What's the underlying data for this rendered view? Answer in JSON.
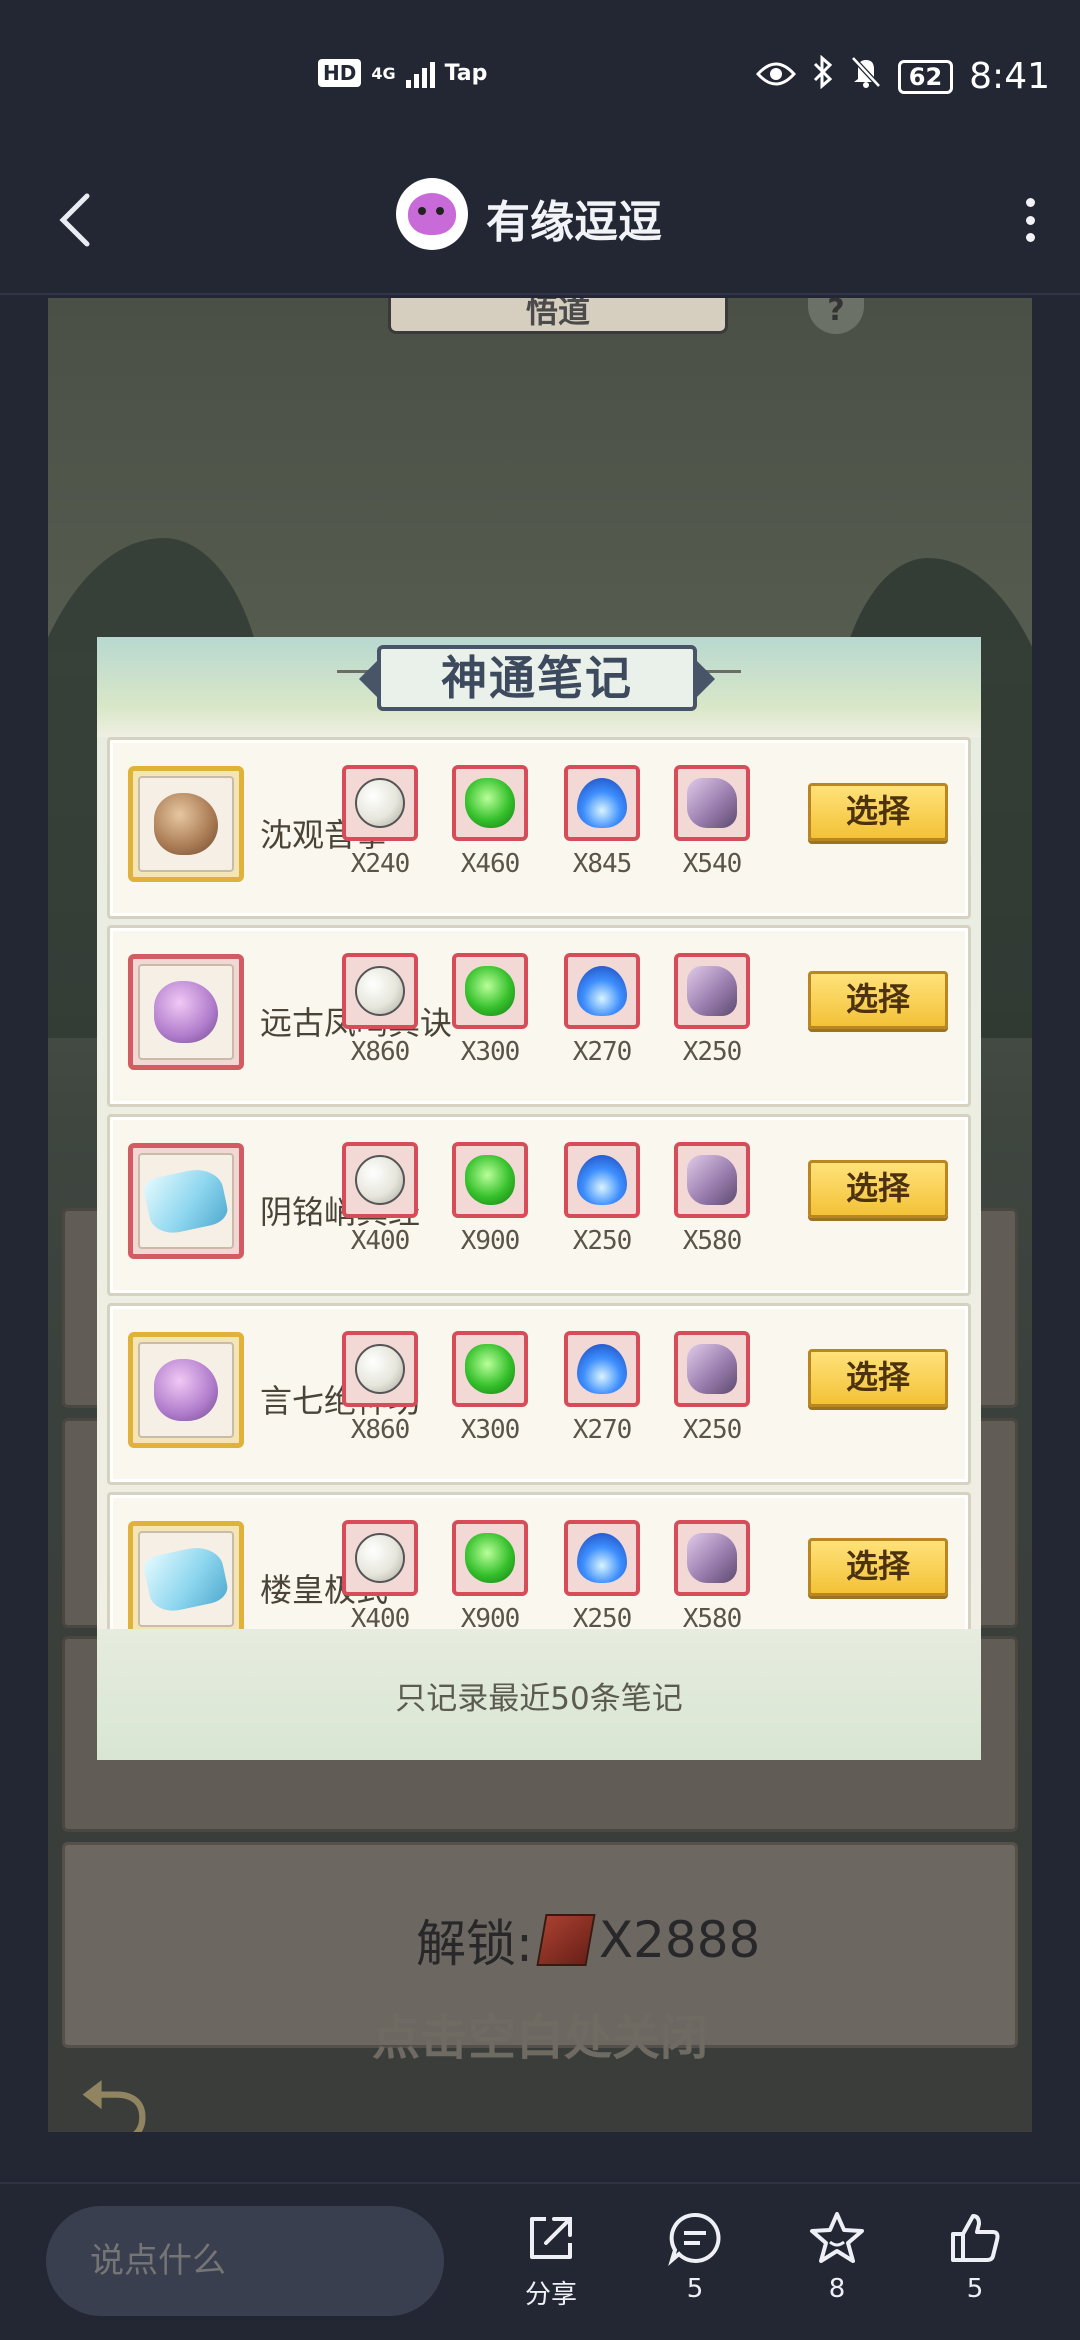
{
  "status_bar": {
    "network_badge": "HD",
    "network_type": "4G",
    "carrier": "Tap",
    "battery": "62",
    "time": "8:41"
  },
  "header": {
    "title": "有缘逗逗"
  },
  "game_background": {
    "panel_title": "悟道",
    "help_label": "?",
    "unlock_label": "解锁:",
    "unlock_cost": "X2888",
    "close_tip": "点击空白处关闭"
  },
  "modal": {
    "title": "神通笔记",
    "select_label": "选择",
    "footer_note": "只记录最近50条笔记",
    "materials": [
      "pearl",
      "green-jade",
      "blue-flame",
      "purple-ore"
    ],
    "rows": [
      {
        "name": "沈观音拳",
        "frame": "gold",
        "stone": "brown",
        "counts": [
          "X240",
          "X460",
          "X845",
          "X540"
        ]
      },
      {
        "name": "远古凤鸣真诀",
        "frame": "red",
        "stone": "purple",
        "counts": [
          "X860",
          "X300",
          "X270",
          "X250"
        ]
      },
      {
        "name": "阴铭峭真经",
        "frame": "red",
        "stone": "ice",
        "counts": [
          "X400",
          "X900",
          "X250",
          "X580"
        ]
      },
      {
        "name": "言七绝神功",
        "frame": "gold",
        "stone": "purple",
        "counts": [
          "X860",
          "X300",
          "X270",
          "X250"
        ]
      },
      {
        "name": "楼皇极式",
        "frame": "gold",
        "stone": "ice",
        "counts": [
          "X400",
          "X900",
          "X250",
          "X580"
        ]
      }
    ]
  },
  "bottom_bar": {
    "comment_placeholder": "说点什么",
    "share_label": "分享",
    "comment_count": "5",
    "favorite_count": "8",
    "like_count": "5"
  }
}
